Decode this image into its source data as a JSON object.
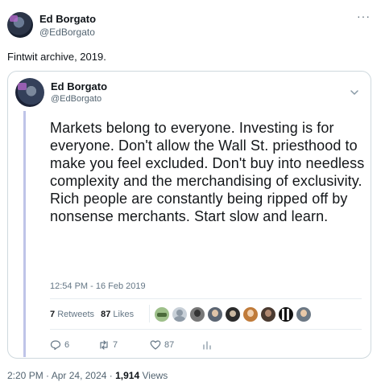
{
  "outer": {
    "author_name": "Ed Borgato",
    "author_handle": "@EdBorgato",
    "more_label": "···",
    "text": "Fintwit archive, 2019."
  },
  "quoted": {
    "author_name": "Ed Borgato",
    "author_handle": "@EdBorgato",
    "text": "Markets belong to everyone. Investing is for everyone. Don't allow the Wall St. priesthood to make you feel excluded. Don't buy into needless complexity and the merchandising of exclusivity. Rich people are constantly being ripped off by nonsense merchants. Start slow and learn.",
    "timestamp": "12:54 PM - 16 Feb 2019",
    "retweets_count": "7",
    "retweets_label": "Retweets",
    "likes_count": "87",
    "likes_label": "Likes",
    "replies": "6",
    "retweets": "7",
    "likes": "87"
  },
  "footer": {
    "time": "2:20 PM",
    "separator": " · ",
    "date": "Apr 24, 2024",
    "views_count": "1,914",
    "views_label": "Views"
  },
  "colors": {
    "text": "#0f1419",
    "secondary": "#536471",
    "border": "#cfd9de",
    "thread_line": "#bfc4e8"
  }
}
